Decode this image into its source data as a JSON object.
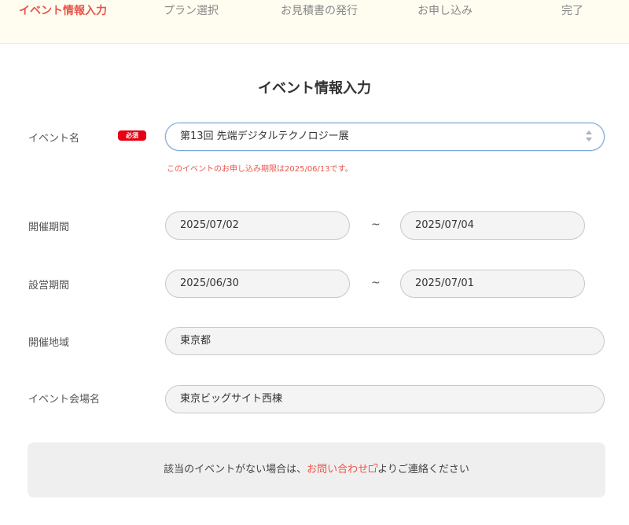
{
  "steps": {
    "s1": "イベント情報入力",
    "s2": "プラン選択",
    "s3": "お見積書の発行",
    "s4": "お申し込み",
    "s5": "完了"
  },
  "page_title": "イベント情報入力",
  "fields": {
    "event_name_label": "イベント名",
    "required_badge": "必須",
    "event_name_value": "第13回 先端デジタルテクノロジー展",
    "deadline_note": "このイベントのお申し込み期限は2025/06/13です。",
    "period_label": "開催期間",
    "period_start": "2025/07/02",
    "period_end": "2025/07/04",
    "setup_label": "設営期間",
    "setup_start": "2025/06/30",
    "setup_end": "2025/07/01",
    "tilde": "~",
    "region_label": "開催地域",
    "region_value": "東京都",
    "venue_label": "イベント会場名",
    "venue_value": "東京ビッグサイト西棟"
  },
  "notice": {
    "before": "該当のイベントがない場合は、",
    "link": "お問い合わせ",
    "after": "よりご連絡ください"
  },
  "colors": {
    "accent": "#e9554b",
    "required": "#e60012",
    "header_bg": "#fffdf0"
  }
}
